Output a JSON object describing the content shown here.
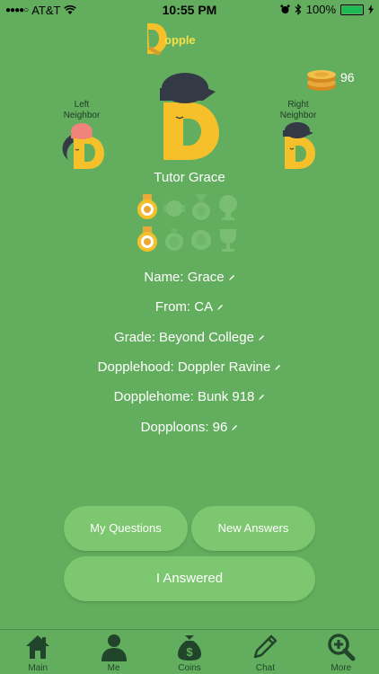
{
  "status_bar": {
    "signal": "●●●●○",
    "carrier": "AT&T",
    "time": "10:55 PM",
    "battery": "100%"
  },
  "logo": {
    "text": "opple"
  },
  "coins": {
    "count": "96"
  },
  "neighbors": {
    "left_label_line1": "Left",
    "left_label_line2": "Neighbor",
    "right_label_line1": "Right",
    "right_label_line2": "Neighbor"
  },
  "profile": {
    "title": "Tutor Grace",
    "name": "Name: Grace",
    "from": "From: CA",
    "grade": "Grade: Beyond College",
    "dopplehood": "Dopplehood: Doppler Ravine",
    "dopplehome": "Dopplehome: Bunk 918",
    "dopploons": "Dopploons: 96"
  },
  "buttons": {
    "my_questions": "My Questions",
    "new_answers": "New Answers",
    "i_answered": "I Answered"
  },
  "tabs": [
    {
      "label": "Main",
      "icon": "home-icon"
    },
    {
      "label": "Me",
      "icon": "person-icon"
    },
    {
      "label": "Coins",
      "icon": "money-bag-icon"
    },
    {
      "label": "Chat",
      "icon": "pencil-icon"
    },
    {
      "label": "More",
      "icon": "zoom-plus-icon"
    }
  ],
  "colors": {
    "background": "#63ae5e",
    "button": "#7cc76f",
    "brand_yellow": "#f6c02b",
    "cap_dark": "#333a45",
    "tab_icon": "#21452b"
  }
}
